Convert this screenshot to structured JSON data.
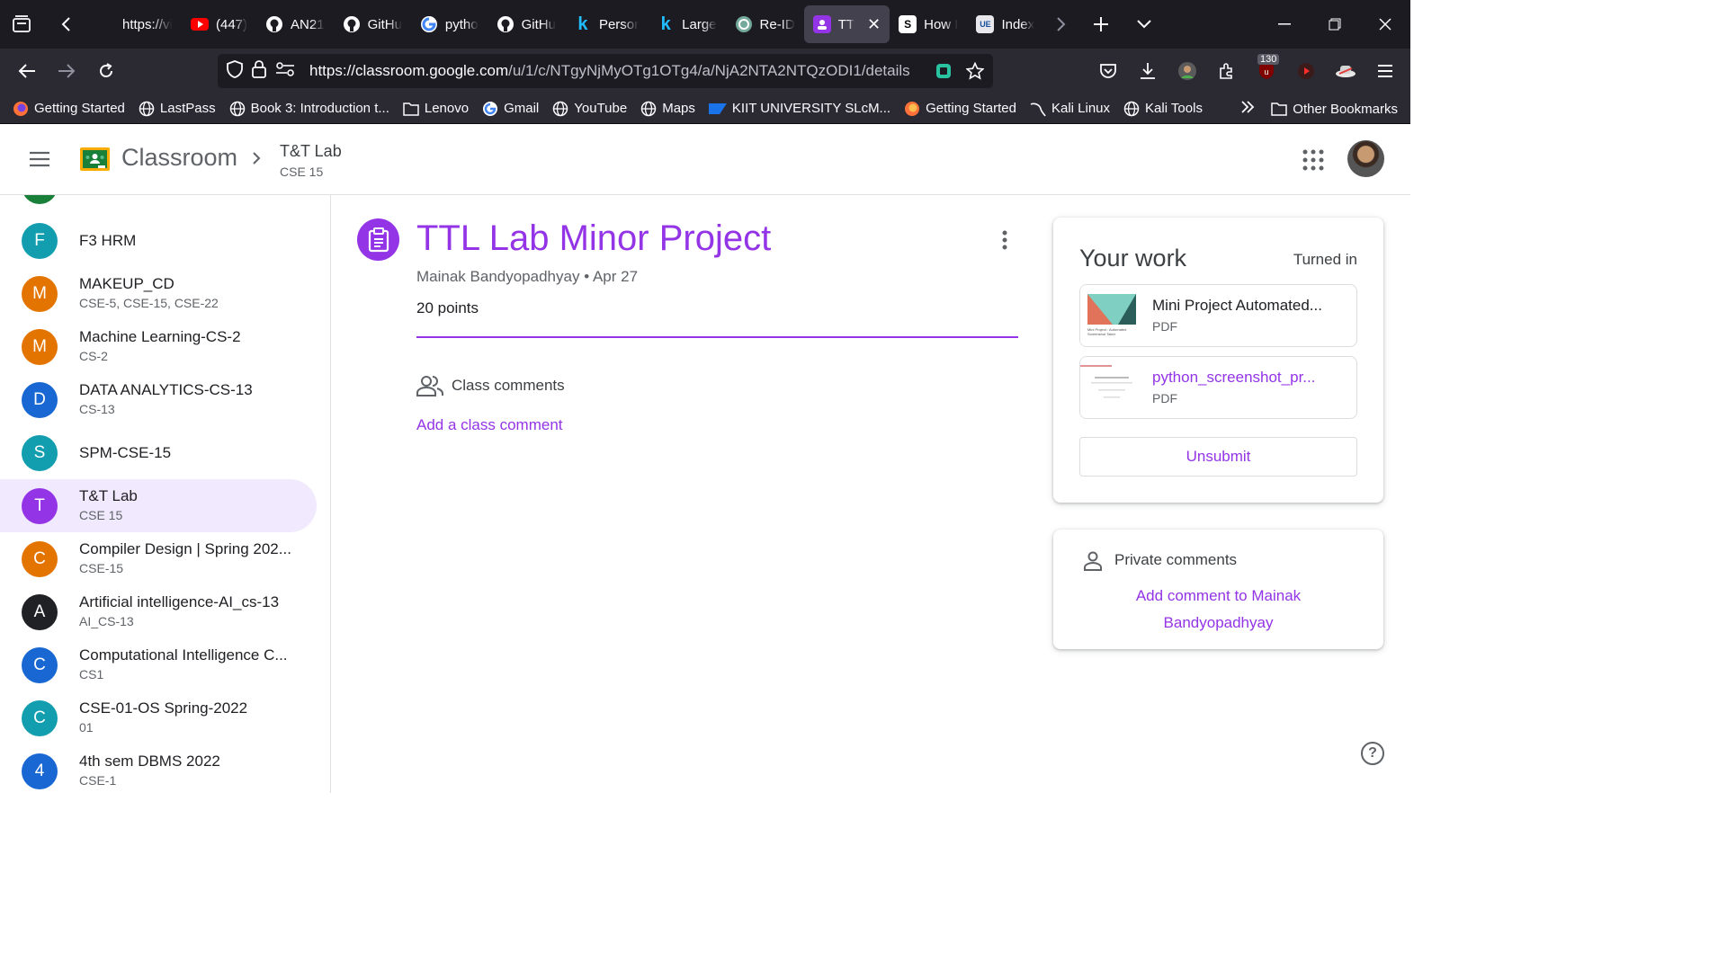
{
  "browser": {
    "tabs": [
      {
        "label": "https://viv",
        "icon": "globe-icon",
        "color": "#fbfbfe"
      },
      {
        "label": "(447)",
        "icon": "youtube-icon",
        "color": "#ff0000"
      },
      {
        "label": "AN21",
        "icon": "github-icon",
        "color": "#fbfbfe"
      },
      {
        "label": "GitHu",
        "icon": "github-icon",
        "color": "#fbfbfe"
      },
      {
        "label": "pytho",
        "icon": "google-icon",
        "color": "#fbfbfe"
      },
      {
        "label": "GitHu",
        "icon": "github-icon",
        "color": "#fbfbfe"
      },
      {
        "label": "Persor",
        "icon": "k-icon",
        "color": "#20beff"
      },
      {
        "label": "Large",
        "icon": "k-icon",
        "color": "#20beff"
      },
      {
        "label": "Re-ID",
        "icon": "openai-icon",
        "color": "#74aa9c"
      },
      {
        "label": "TT",
        "icon": "classroom-icon",
        "color": "#9334e6"
      },
      {
        "label": "How I",
        "icon": "s-icon",
        "color": "#fbfbfe"
      },
      {
        "label": "Index",
        "icon": "ue-icon",
        "color": "#fbfbfe"
      }
    ],
    "url_host": "https://classroom.google.com",
    "url_path": "/u/1/c/NTgyNjMyOTg1OTg4/a/NjA2NTA2NTQzODI1/details",
    "badge_count": "130",
    "bookmarks": [
      {
        "label": "Getting Started",
        "icon": "firefox-icon"
      },
      {
        "label": "LastPass",
        "icon": "globe-icon"
      },
      {
        "label": "Book 3: Introduction t...",
        "icon": "globe-icon"
      },
      {
        "label": "Lenovo",
        "icon": "folder-icon"
      },
      {
        "label": "Gmail",
        "icon": "google-icon"
      },
      {
        "label": "YouTube",
        "icon": "globe-icon"
      },
      {
        "label": "Maps",
        "icon": "globe-icon"
      },
      {
        "label": "KIIT UNIVERSITY SLcM...",
        "icon": "sap-icon"
      },
      {
        "label": "Getting Started",
        "icon": "firefox-icon"
      },
      {
        "label": "Kali Linux",
        "icon": "kali-icon"
      },
      {
        "label": "Kali Tools",
        "icon": "globe-icon"
      }
    ],
    "other_bookmarks": "Other Bookmarks"
  },
  "header": {
    "brand": "Classroom",
    "class_name": "T&T Lab",
    "class_section": "CSE 15"
  },
  "sidebar": {
    "courses": [
      {
        "initial": "F",
        "name": "F3 HRM",
        "section": "",
        "color": "#129eaf"
      },
      {
        "initial": "M",
        "name": "MAKEUP_CD",
        "section": "CSE-5, CSE-15, CSE-22",
        "color": "#e37400"
      },
      {
        "initial": "M",
        "name": "Machine Learning-CS-2",
        "section": "CS-2",
        "color": "#e37400"
      },
      {
        "initial": "D",
        "name": "DATA ANALYTICS-CS-13",
        "section": "CS-13",
        "color": "#1967d2"
      },
      {
        "initial": "S",
        "name": "SPM-CSE-15",
        "section": "",
        "color": "#129eaf"
      },
      {
        "initial": "T",
        "name": "T&T Lab",
        "section": "CSE 15",
        "color": "#9334e6",
        "active": true
      },
      {
        "initial": "C",
        "name": "Compiler Design | Spring 202...",
        "section": "CSE-15",
        "color": "#e37400"
      },
      {
        "initial": "A",
        "name": "Artificial intelligence-AI_cs-13",
        "section": "AI_CS-13",
        "color": "#202124"
      },
      {
        "initial": "C",
        "name": "Computational Intelligence C...",
        "section": "CS1",
        "color": "#1967d2"
      },
      {
        "initial": "C",
        "name": "CSE-01-OS Spring-2022",
        "section": "01",
        "color": "#129eaf"
      },
      {
        "initial": "4",
        "name": "4th sem DBMS 2022",
        "section": "CSE-1",
        "color": "#1967d2"
      }
    ]
  },
  "assignment": {
    "title": "TTL Lab Minor Project",
    "author": "Mainak Bandyopadhyay",
    "date": "Apr 27",
    "points": "20 points",
    "class_comments_label": "Class comments",
    "add_class_comment": "Add a class comment"
  },
  "your_work": {
    "title": "Your work",
    "status": "Turned in",
    "files": [
      {
        "name": "Mini Project Automated...",
        "type": "PDF",
        "thumb_caption": "Mini Project : Automated Screenshot Taker"
      },
      {
        "name": "python_screenshot_pr...",
        "type": "PDF"
      }
    ],
    "unsubmit_label": "Unsubmit"
  },
  "private_comments": {
    "label": "Private comments",
    "add_label": "Add comment to Mainak Bandyopadhyay"
  },
  "colors": {
    "accent": "#9334e6",
    "chrome_dark": "#1c1b22",
    "chrome": "#2b2a33"
  }
}
